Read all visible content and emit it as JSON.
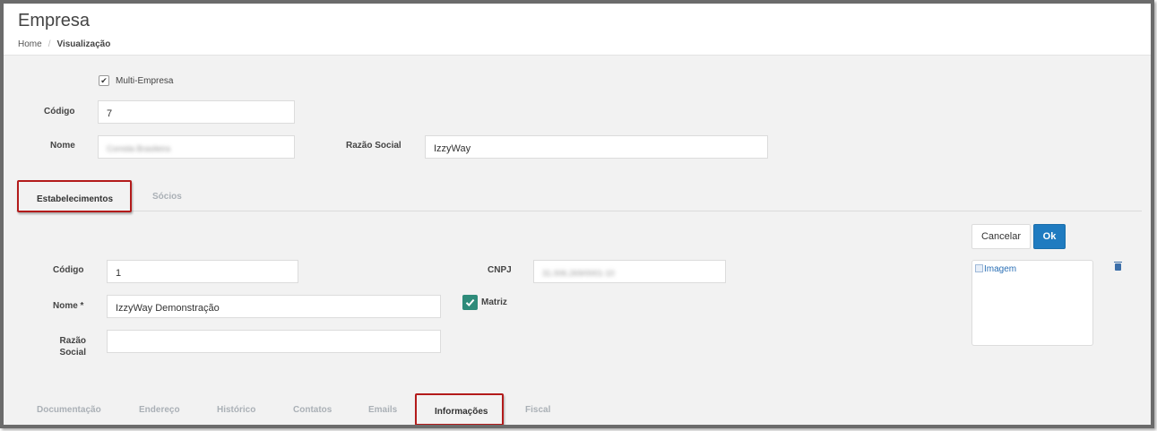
{
  "header": {
    "title": "Empresa",
    "breadcrumb": {
      "home": "Home",
      "separator": "/",
      "current": "Visualização"
    }
  },
  "company": {
    "multi_empresa_label": "Multi-Empresa",
    "multi_empresa_checked": true,
    "codigo_label": "Código",
    "codigo_value": "7",
    "nome_label": "Nome",
    "nome_value": "Comida Brasileira",
    "razao_social_label": "Razão Social",
    "razao_social_value": "IzzyWay"
  },
  "main_tabs": [
    {
      "label": "Estabelecimentos",
      "active": true
    },
    {
      "label": "Sócios",
      "active": false
    }
  ],
  "establishment": {
    "cancel_label": "Cancelar",
    "ok_label": "Ok",
    "codigo_label": "Código",
    "codigo_value": "1",
    "cnpj_label": "CNPJ",
    "cnpj_value": "31.006.269/0001-10",
    "nome_label": "Nome *",
    "nome_value": "IzzyWay Demonstração",
    "matriz_label": "Matriz",
    "matriz_checked": true,
    "razao_label_line1": "Razão",
    "razao_label_line2": "Social",
    "razao_value": "",
    "image_alt": "Imagem"
  },
  "sub_tabs": [
    {
      "label": "Documentação",
      "active": false
    },
    {
      "label": "Endereço",
      "active": false
    },
    {
      "label": "Histórico",
      "active": false
    },
    {
      "label": "Contatos",
      "active": false
    },
    {
      "label": "Emails",
      "active": false
    },
    {
      "label": "Informações",
      "active": true
    },
    {
      "label": "Fiscal",
      "active": false
    }
  ],
  "colors": {
    "primary_button": "#1f7bc0",
    "matriz_check": "#2e8b7a",
    "highlight_border": "#b31b1b",
    "inactive_tab": "#aab0b6"
  },
  "icons": {
    "checkbox": "check-icon",
    "trash": "trash-icon",
    "broken_image": "broken-image-icon"
  }
}
